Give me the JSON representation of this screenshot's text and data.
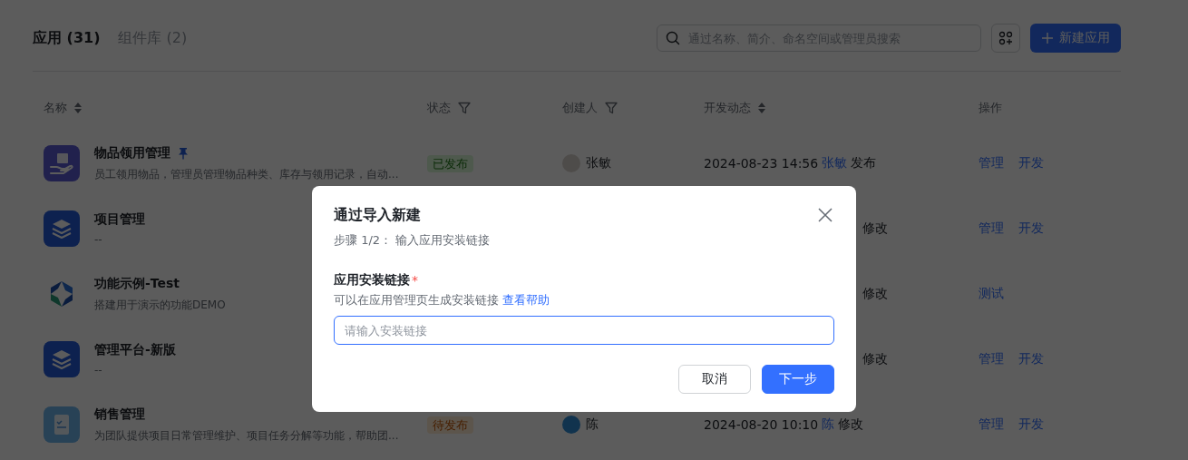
{
  "tabs": [
    {
      "label": "应用 (31)",
      "selected": true
    },
    {
      "label": "组件库 (2)",
      "selected": false
    }
  ],
  "search": {
    "placeholder": "通过名称、简介、命名空间或管理员搜索"
  },
  "new_button": {
    "label": "新建应用"
  },
  "table": {
    "columns": [
      {
        "label": "名称",
        "kind": "sort"
      },
      {
        "label": "状态",
        "kind": "filter"
      },
      {
        "label": "创建人",
        "kind": "filter"
      },
      {
        "label": "开发动态",
        "kind": "sort"
      },
      {
        "label": "操作",
        "kind": "plain"
      }
    ],
    "rows": [
      {
        "kind": "hand",
        "name": "物品领用管理",
        "pinned": true,
        "description": "员工领用物品，管理员管理物品种类、库存与领用记录，自动...",
        "status": {
          "label": "已发布",
          "kind": "published"
        },
        "creator": {
          "name": "张敏",
          "kind": "photo"
        },
        "activity": {
          "time": "2024-08-23 14:56",
          "actor": "张敏",
          "action": "发布"
        },
        "actions": [
          "管理",
          "开发"
        ]
      },
      {
        "kind": "layers",
        "name": "项目管理",
        "pinned": false,
        "description": "--",
        "activity": {
          "action": "修改"
        },
        "actions": [
          "管理",
          "开发"
        ]
      },
      {
        "kind": "hexagon",
        "name": "功能示例-Test",
        "pinned": false,
        "description": "搭建用于演示的功能DEMO",
        "activity": {
          "action": "修改"
        },
        "actions": [
          "测试"
        ]
      },
      {
        "kind": "layers",
        "name": "管理平台-新版",
        "pinned": false,
        "description": "--",
        "activity": {
          "action": "修改"
        },
        "actions": [
          "管理",
          "开发"
        ]
      },
      {
        "kind": "document",
        "name": "销售管理",
        "pinned": false,
        "description": "为团队提供项目日常管理维护、项目任务分解等功能，帮助团...",
        "status": {
          "label": "待发布",
          "kind": "pending"
        },
        "creator": {
          "name": "陈",
          "kind": "initial"
        },
        "activity": {
          "time": "2024-08-20 10:10",
          "actor": "陈",
          "action": "修改"
        },
        "actions": [
          "管理",
          "开发"
        ]
      }
    ]
  },
  "dialog": {
    "title": "通过导入新建",
    "step": "步骤 1/2： 输入应用安装链接",
    "field_label": "应用安装链接",
    "required_mark": "*",
    "hint": "可以在应用管理页生成安装链接",
    "help_link": "查看帮助",
    "placeholder": "请输入安装链接",
    "buttons": [
      {
        "label": "取消",
        "kind": "secondary"
      },
      {
        "label": "下一步",
        "kind": "primary"
      }
    ]
  }
}
